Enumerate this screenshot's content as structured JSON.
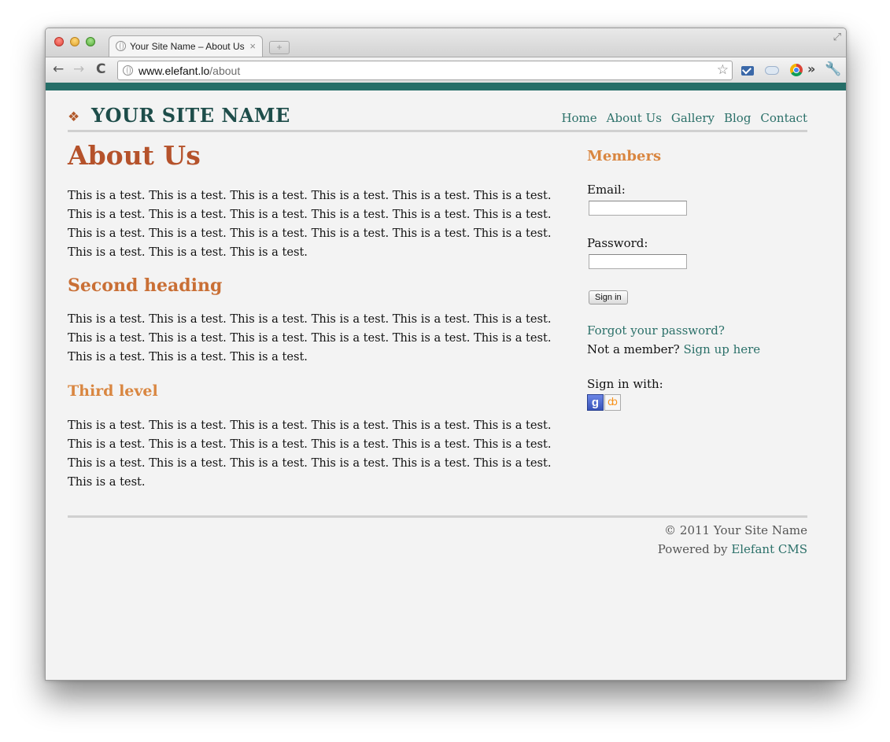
{
  "browser": {
    "tab_title": "Your Site Name – About Us",
    "tab_close": "×",
    "new_tab": "+",
    "url_host": "www.elefant.lo",
    "url_path": "/about",
    "back": "←",
    "forward": "→",
    "reload": "C",
    "star": "☆",
    "more": "»",
    "wrench": "🔧",
    "fullscreen": "⤢"
  },
  "site": {
    "logo_mark": "❖",
    "name": "YOUR SITE NAME",
    "nav": [
      "Home",
      "About Us",
      "Gallery",
      "Blog",
      "Contact"
    ]
  },
  "content": {
    "h1": "About Us",
    "p1": "This is a test. This is a test. This is a test. This is a test. This is a test. This is a test. This is a test. This is a test. This is a test. This is a test. This is a test. This is a test. This is a test. This is a test. This is a test. This is a test. This is a test. This is a test. This is a test. This is a test. This is a test.",
    "h2": "Second heading",
    "p2": "This is a test. This is a test. This is a test. This is a test. This is a test. This is a test. This is a test. This is a test. This is a test. This is a test. This is a test. This is a test. This is a test. This is a test. This is a test.",
    "h3": "Third level",
    "p3": "This is a test. This is a test. This is a test. This is a test. This is a test. This is a test. This is a test. This is a test. This is a test. This is a test. This is a test. This is a test. This is a test. This is a test. This is a test. This is a test. This is a test. This is a test. This is a test."
  },
  "sidebar": {
    "title": "Members",
    "email_label": "Email:",
    "password_label": "Password:",
    "signin_button": "Sign in",
    "forgot": "Forgot your password?",
    "not_member": "Not a member?",
    "signup": "Sign up here",
    "signin_with": "Sign in with:",
    "google_glyph": "g",
    "openid_glyph": "ȸ"
  },
  "footer": {
    "copyright": "© 2011 Your Site Name",
    "powered_by": "Powered by",
    "cms": "Elefant CMS"
  }
}
